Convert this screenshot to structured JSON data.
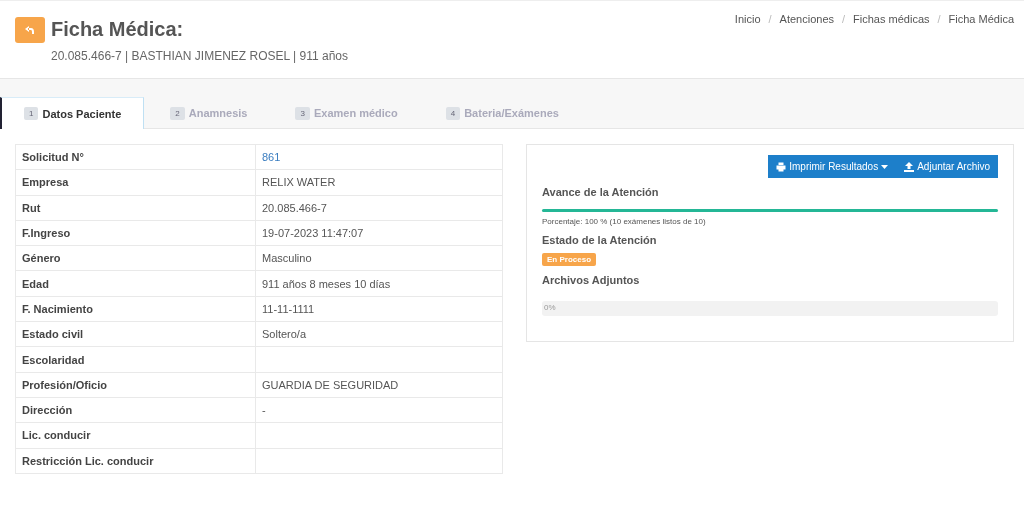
{
  "header": {
    "title": "Ficha Médica:",
    "subtitle": "20.085.466-7 | BASTHIAN JIMENEZ ROSEL | 911 años"
  },
  "breadcrumb": [
    {
      "label": "Inicio"
    },
    {
      "separator": "/",
      "label": "Atenciones"
    },
    {
      "separator": "/",
      "label": "Fichas médicas"
    },
    {
      "separator": "/",
      "label": "Ficha Médica"
    }
  ],
  "tabs": [
    {
      "number": "1",
      "label": "Datos Paciente",
      "selected": true
    },
    {
      "number": "2",
      "label": "Anamnesis",
      "selected": false
    },
    {
      "number": "3",
      "label": "Examen médico",
      "selected": false
    },
    {
      "number": "4",
      "label": "Bateria/Exámenes",
      "selected": false
    }
  ],
  "patient_table": [
    {
      "label": "Solicitud N°",
      "value": "861",
      "kind": "link"
    },
    {
      "label": "Empresa",
      "value": "RELIX WATER",
      "kind": "text"
    },
    {
      "label": "Rut",
      "value": "20.085.466-7",
      "kind": "text"
    },
    {
      "label": "F.Ingreso",
      "value": "19-07-2023 11:47:07",
      "kind": "text"
    },
    {
      "label": "Género",
      "value": "Masculino",
      "kind": "text"
    },
    {
      "label": "Edad",
      "value": "911 años 8 meses 10 días",
      "kind": "text"
    },
    {
      "label": "F. Nacimiento",
      "value": "11-11-1111",
      "kind": "text"
    },
    {
      "label": "Estado civil",
      "value": "Soltero/a",
      "kind": "text"
    },
    {
      "label": "Escolaridad",
      "kind": "text"
    },
    {
      "label": "Profesión/Oficio",
      "value": "GUARDIA DE SEGURIDAD",
      "kind": "text"
    },
    {
      "label": "Dirección",
      "value": "-",
      "kind": "text"
    },
    {
      "label": "Lic. conducir",
      "kind": "text"
    },
    {
      "label": "Restricción Lic. conducir",
      "kind": "text"
    }
  ],
  "panel": {
    "buttons": [
      "Imprimir Resultados",
      "Adjuntar Archivo"
    ],
    "progress_title": "Avance de la Atención",
    "progress": {
      "level": 1
    },
    "progress_text": "Porcentaje: 100 % (10 exámenes listos de 10)",
    "status_title": "Estado de la Atención",
    "status_badge": "En Proceso",
    "attachments_title": "Archivos Adjuntos",
    "upload": {
      "level": 0,
      "reading": "0%"
    }
  }
}
